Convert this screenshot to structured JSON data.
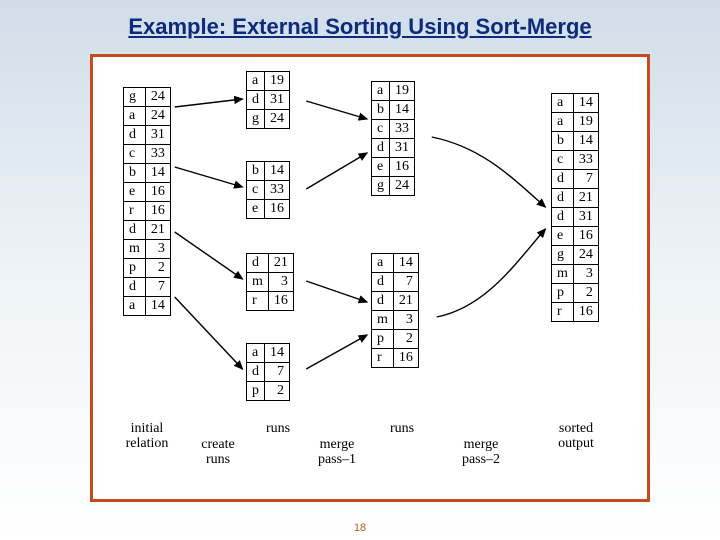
{
  "title": "Example: External Sorting Using Sort-Merge",
  "page_number": "18",
  "labels": {
    "initial": "initial\nrelation",
    "create_runs": "create\nruns",
    "runs1": "runs",
    "merge1": "merge\npass–1",
    "runs2": "runs",
    "merge2": "merge\npass–2",
    "sorted": "sorted\noutput"
  },
  "columns": {
    "initial": [
      [
        "g",
        "24"
      ],
      [
        "a",
        "24"
      ],
      [
        "d",
        "31"
      ],
      [
        "c",
        "33"
      ],
      [
        "b",
        "14"
      ],
      [
        "e",
        "16"
      ],
      [
        "r",
        "16"
      ],
      [
        "d",
        "21"
      ],
      [
        "m",
        "3"
      ],
      [
        "p",
        "2"
      ],
      [
        "d",
        "7"
      ],
      [
        "a",
        "14"
      ]
    ],
    "runs1": {
      "r1": [
        [
          "a",
          "19"
        ],
        [
          "d",
          "31"
        ],
        [
          "g",
          "24"
        ]
      ],
      "r2": [
        [
          "b",
          "14"
        ],
        [
          "c",
          "33"
        ],
        [
          "e",
          "16"
        ]
      ],
      "r3": [
        [
          "d",
          "21"
        ],
        [
          "m",
          "3"
        ],
        [
          "r",
          "16"
        ]
      ],
      "r4": [
        [
          "a",
          "14"
        ],
        [
          "d",
          "7"
        ],
        [
          "p",
          "2"
        ]
      ]
    },
    "runs2": {
      "r1": [
        [
          "a",
          "19"
        ],
        [
          "b",
          "14"
        ],
        [
          "c",
          "33"
        ],
        [
          "d",
          "31"
        ],
        [
          "e",
          "16"
        ],
        [
          "g",
          "24"
        ]
      ],
      "r2": [
        [
          "a",
          "14"
        ],
        [
          "d",
          "7"
        ],
        [
          "d",
          "21"
        ],
        [
          "m",
          "3"
        ],
        [
          "p",
          "2"
        ],
        [
          "r",
          "16"
        ]
      ]
    },
    "sorted": [
      [
        "a",
        "14"
      ],
      [
        "a",
        "19"
      ],
      [
        "b",
        "14"
      ],
      [
        "c",
        "33"
      ],
      [
        "d",
        "7"
      ],
      [
        "d",
        "21"
      ],
      [
        "d",
        "31"
      ],
      [
        "e",
        "16"
      ],
      [
        "g",
        "24"
      ],
      [
        "m",
        "3"
      ],
      [
        "p",
        "2"
      ],
      [
        "r",
        "16"
      ]
    ]
  }
}
